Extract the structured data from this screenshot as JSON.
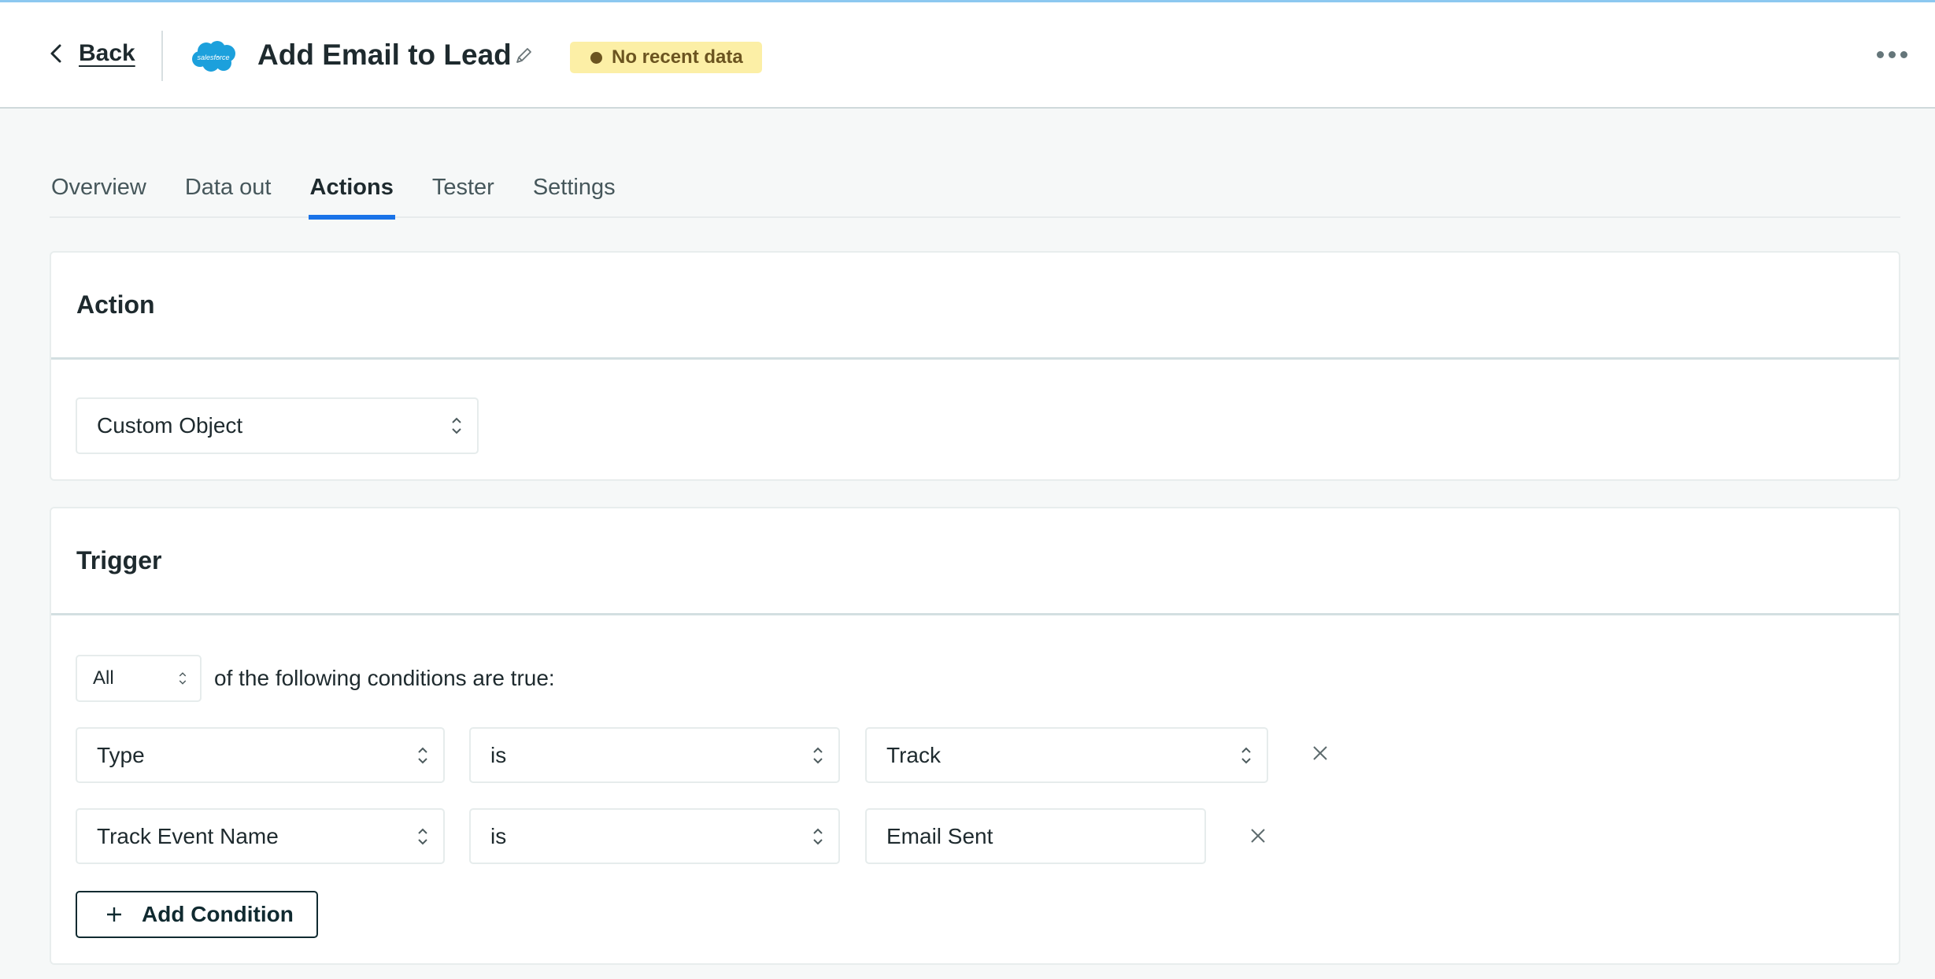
{
  "header": {
    "back_label": "Back",
    "logo_text": "salesforce",
    "title": "Add Email to Lead",
    "status_badge": "No recent data",
    "colors": {
      "badge_bg": "#fcefa6",
      "badge_text": "#6b5420",
      "accent": "#1a73e8",
      "logo": "#1ca0dc"
    }
  },
  "tabs": [
    {
      "label": "Overview",
      "active": false
    },
    {
      "label": "Data out",
      "active": false
    },
    {
      "label": "Actions",
      "active": true
    },
    {
      "label": "Tester",
      "active": false
    },
    {
      "label": "Settings",
      "active": false
    }
  ],
  "action_card": {
    "title": "Action",
    "select_value": "Custom Object"
  },
  "trigger_card": {
    "title": "Trigger",
    "match_select": "All",
    "match_text": "of the following conditions are true:",
    "conditions": [
      {
        "field": "Type",
        "operator": "is",
        "value": "Track",
        "value_kind": "select"
      },
      {
        "field": "Track Event Name",
        "operator": "is",
        "value": "Email Sent",
        "value_kind": "input"
      }
    ],
    "add_condition_label": "Add Condition"
  }
}
